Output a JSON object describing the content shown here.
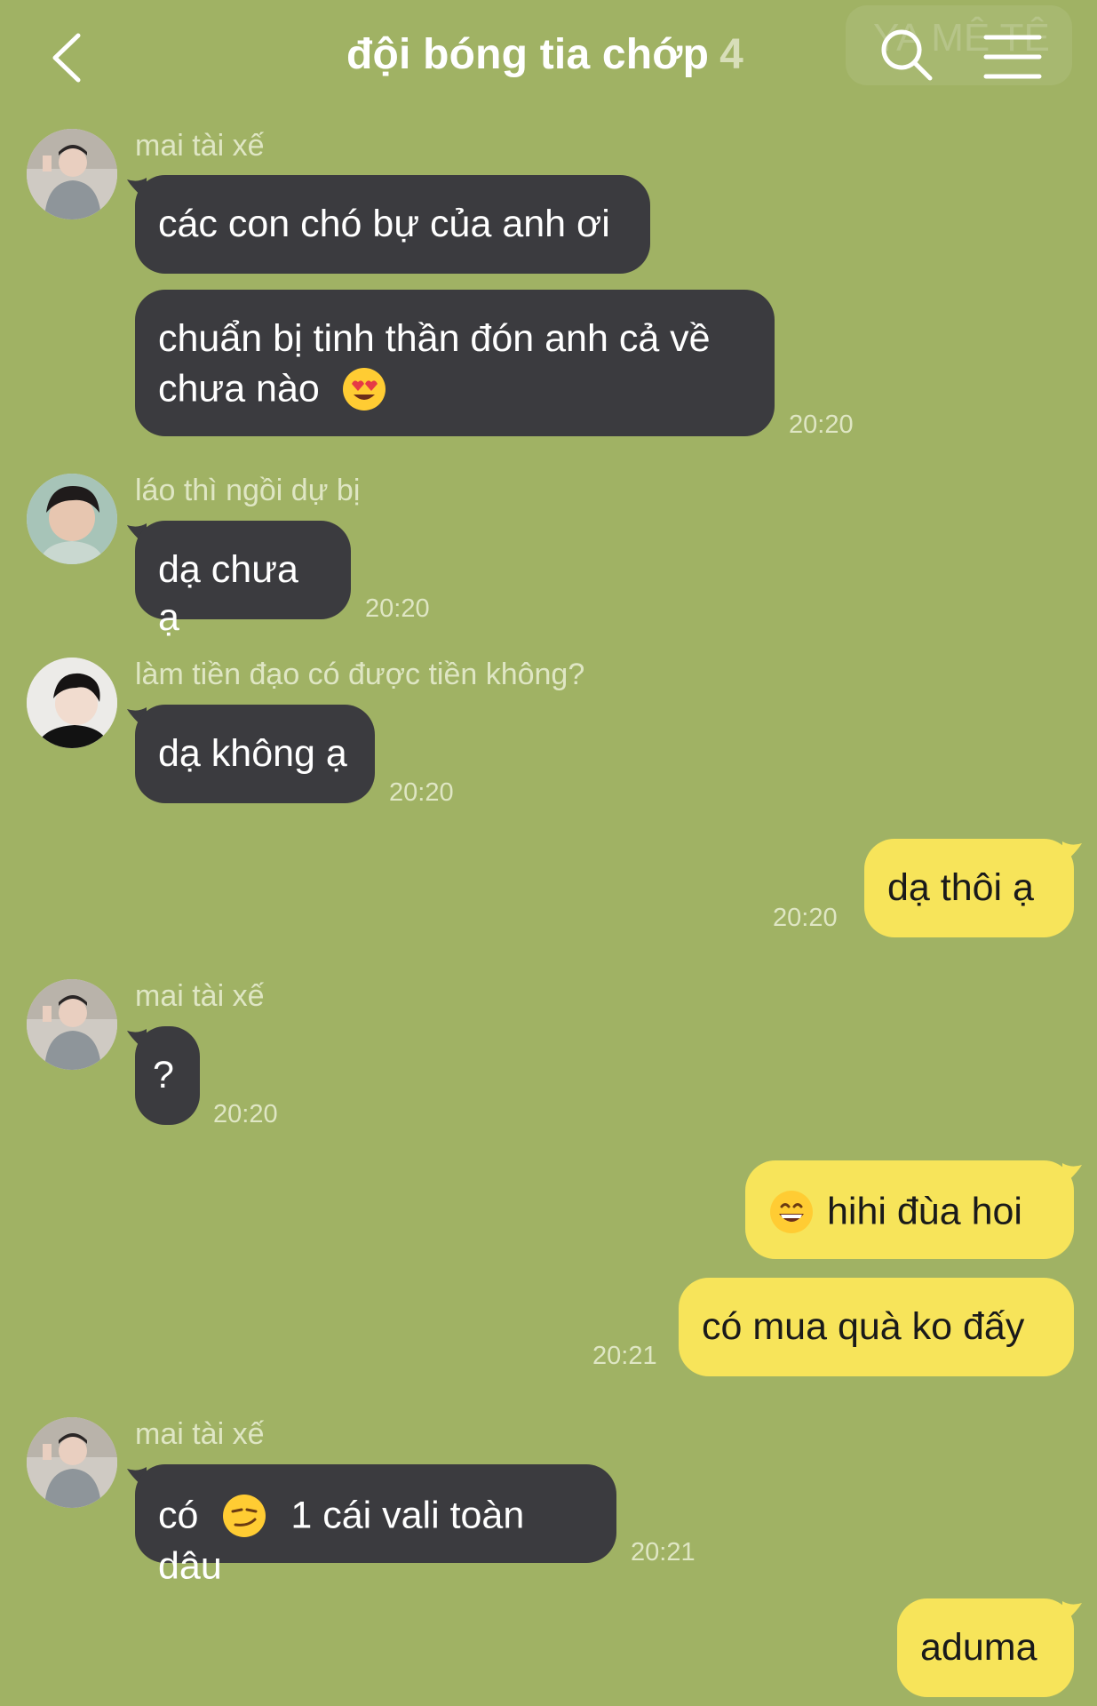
{
  "header": {
    "title": "đội bóng tia chớp",
    "member_count": "4",
    "watermark": "YA MÊ TÊ"
  },
  "messages": [
    {
      "sender": "mai tài xế",
      "bubbles": [
        "các con chó bự của anh ơi",
        "chuẩn bị tinh thần đón anh cả về",
        "chưa nào"
      ],
      "emoji": "heart-eyes-emoji",
      "time": "20:20"
    },
    {
      "sender": "láo thì ngồi dự bị",
      "bubbles": [
        "dạ chưa ạ"
      ],
      "time": "20:20"
    },
    {
      "sender": "làm tiền đạo có được tiền không?",
      "bubbles": [
        "dạ không ạ"
      ],
      "time": "20:20"
    },
    {
      "sender": "me",
      "bubbles": [
        "dạ thôi ạ"
      ],
      "time": "20:20"
    },
    {
      "sender": "mai tài xế",
      "bubbles": [
        "?"
      ],
      "time": "20:20"
    },
    {
      "sender": "me",
      "bubbles": [
        "hihi đùa hoi",
        "có mua quà ko đấy"
      ],
      "emoji": "grinning-emoji",
      "time": "20:21"
    },
    {
      "sender": "mai tài xế",
      "bubbles": [
        "có",
        "1 cái vali toàn dâu"
      ],
      "emoji": "smirk-emoji",
      "time": "20:21"
    },
    {
      "sender": "me",
      "bubbles": [
        "aduma"
      ]
    }
  ],
  "colors": {
    "background": "#a0b264",
    "incoming_bubble": "#3b3b3f",
    "outgoing_bubble": "#f7e45a"
  }
}
